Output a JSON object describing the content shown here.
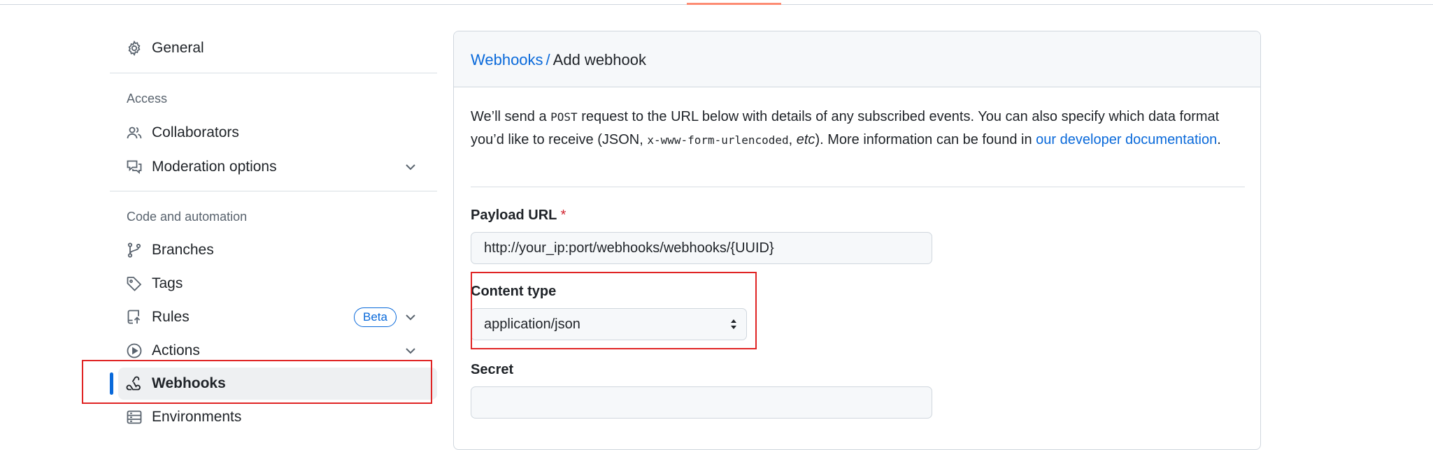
{
  "sidebar": {
    "general_label": "General",
    "access_heading": "Access",
    "collaborators_label": "Collaborators",
    "moderation_label": "Moderation options",
    "code_heading": "Code and automation",
    "branches_label": "Branches",
    "tags_label": "Tags",
    "rules_label": "Rules",
    "rules_badge": "Beta",
    "actions_label": "Actions",
    "webhooks_label": "Webhooks",
    "environments_label": "Environments",
    "active_item": "Webhooks"
  },
  "breadcrumb": {
    "parent": "Webhooks",
    "separator": "/",
    "current": "Add webhook"
  },
  "description": {
    "part1": "We’ll send a ",
    "method": "POST",
    "part2": " request to the URL below with details of any subscribed events. You can also specify which data format you’d like to receive (JSON, ",
    "format_code": "x-www-form-urlencoded",
    "part3": ", ",
    "etc": "etc",
    "part4": "). More information can be found in ",
    "link_text": "our developer documentation",
    "part5": "."
  },
  "form": {
    "payload_url_label": "Payload URL",
    "required_marker": "*",
    "payload_url_value": "http://your_ip:port/webhooks/webhooks/{UUID}",
    "content_type_label": "Content type",
    "content_type_value": "application/json",
    "secret_label": "Secret",
    "secret_value": ""
  },
  "colors": {
    "accent_blue": "#0969da",
    "highlight_red": "#e02424",
    "top_tab_underline": "#fd8c73"
  },
  "icons": [
    "gear-icon",
    "people-icon",
    "comment-discussion-icon",
    "git-branch-icon",
    "tag-icon",
    "repo-push-icon",
    "play-icon",
    "webhook-icon",
    "server-icon",
    "chevron-down-icon",
    "select-arrows-icon"
  ]
}
